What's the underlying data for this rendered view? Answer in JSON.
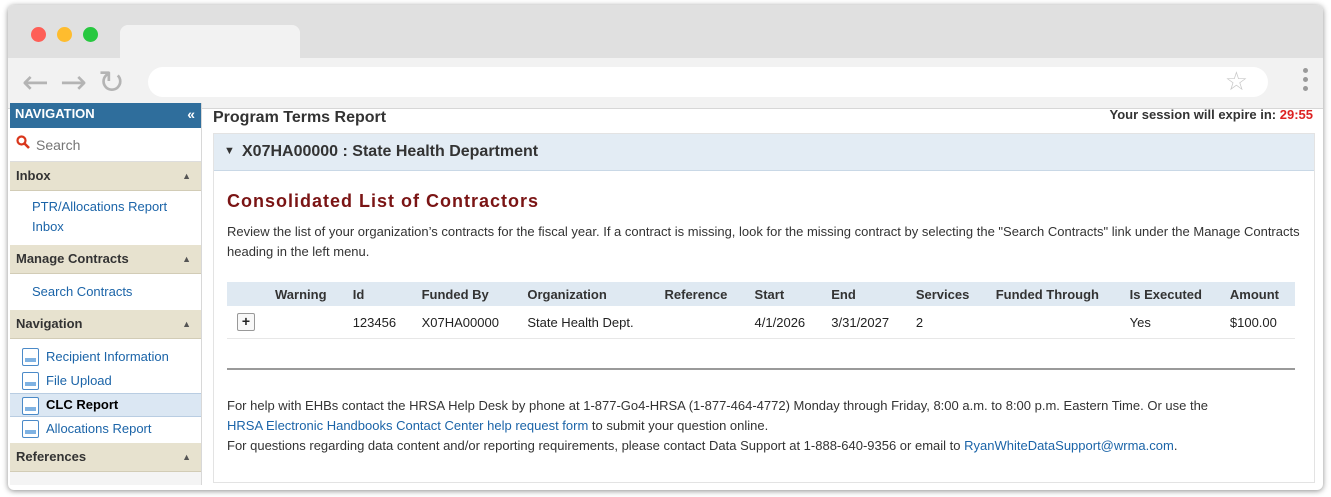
{
  "sidebar": {
    "header": "NAVIGATION",
    "collapse_symbol": "«",
    "search_placeholder": "Search",
    "sections": [
      {
        "title": "Inbox",
        "links": [
          "PTR/Allocations Report Inbox"
        ]
      },
      {
        "title": "Manage Contracts",
        "links": [
          "Search Contracts"
        ]
      },
      {
        "title": "Navigation",
        "items": [
          "Recipient Information",
          "File Upload",
          "CLC Report",
          "Allocations Report"
        ],
        "active": "CLC Report"
      },
      {
        "title": "References"
      }
    ]
  },
  "main": {
    "page_title": "Program Terms Report",
    "session_label": "Your session will expire in:",
    "session_time": "29:55",
    "panel_title": "X07HA00000 : State Health Department",
    "section_title": "Consolidated List of Contractors",
    "description": "Review the list of your organization’s contracts for the fiscal year. If a contract is missing, look for the missing contract by selecting the \"Search Contracts\" link under the Manage Contracts heading in the left menu.",
    "table": {
      "columns": [
        "Warning",
        "Id",
        "Funded By",
        "Organization",
        "Reference",
        "Start",
        "End",
        "Services",
        "Funded Through",
        "Is Executed",
        "Amount"
      ],
      "rows": [
        {
          "expand": "+",
          "warning": "",
          "id": "123456",
          "funded_by": "X07HA00000",
          "organization": "State Health Dept.",
          "reference": "",
          "start": "4/1/2026",
          "end": "3/31/2027",
          "services": "2",
          "funded_through": "",
          "is_executed": "Yes",
          "amount": "$100.00"
        }
      ]
    },
    "footer": {
      "line1": "For help with EHBs contact the HRSA Help Desk by phone at 1-877-Go4-HRSA (1-877-464-4772) Monday through Friday, 8:00 a.m. to 8:00 p.m. Eastern Time. Or use the",
      "link1": "HRSA Electronic Handbooks Contact Center help request form",
      "line2_suffix": " to submit your question online.",
      "line3": "For questions regarding data content and/or reporting requirements, please contact Data Support at 1-888-640-9356 or email to ",
      "email": "RyanWhiteDataSupport@wrma.com",
      "line3_suffix": "."
    }
  },
  "colors": {
    "nav_header": "#2f6e9c",
    "section_title": "#7a1414",
    "link": "#1b64a8",
    "session_time": "#d22222"
  },
  "icons": {
    "search": "search-icon",
    "doc": "document-icon",
    "back": "back-arrow-icon",
    "forward": "forward-arrow-icon",
    "reload": "reload-icon",
    "bookmark": "star-icon"
  }
}
